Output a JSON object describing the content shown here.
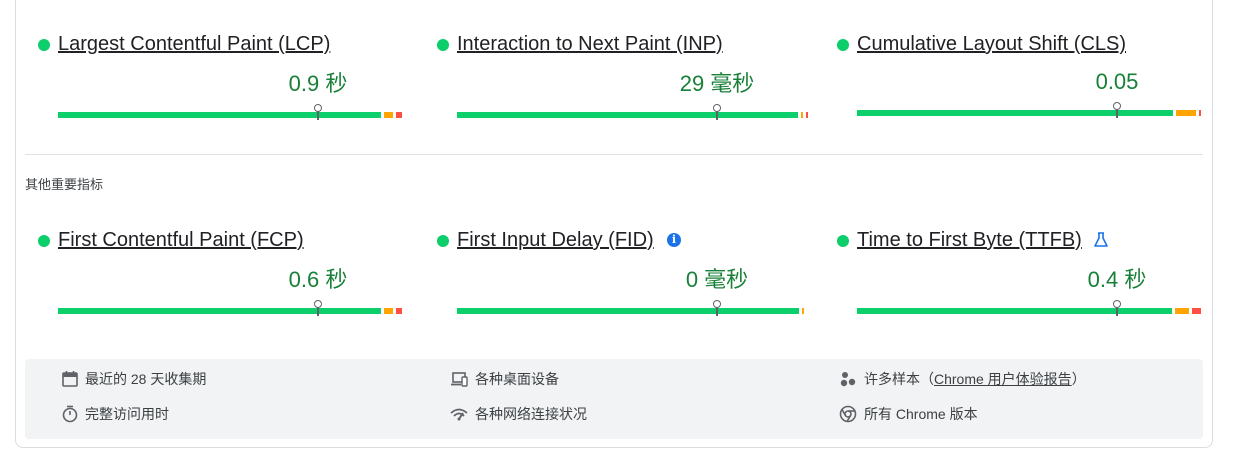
{
  "colors": {
    "good": "#0cce6b",
    "needs_improvement": "#ffa400",
    "poor": "#ff4e42",
    "value_text": "#188038",
    "info_blue": "#1a73e8"
  },
  "core_metrics": [
    {
      "name": "Largest Contentful Paint (LCP)",
      "value": "0.9 秒",
      "status": "good",
      "distribution": {
        "good": 0.94,
        "needs_improvement": 0.035,
        "poor": 0.025
      },
      "marker_fraction": 0.75
    },
    {
      "name": "Interaction to Next Paint (INP)",
      "value": "29 毫秒",
      "status": "good",
      "distribution": {
        "good": 0.99,
        "needs_improvement": 0.007,
        "poor": 0.003
      },
      "marker_fraction": 0.75
    },
    {
      "name": "Cumulative Layout Shift (CLS)",
      "value": "0.05",
      "status": "good",
      "distribution": {
        "good": 0.92,
        "needs_improvement": 0.065,
        "poor": 0.015
      },
      "marker_fraction": 0.75
    }
  ],
  "other_section_label": "其他重要指标",
  "other_metrics": [
    {
      "name": "First Contentful Paint (FCP)",
      "value": "0.6 秒",
      "status": "good",
      "distribution": {
        "good": 0.94,
        "needs_improvement": 0.035,
        "poor": 0.025
      },
      "marker_fraction": 0.75
    },
    {
      "name": "First Input Delay (FID)",
      "value": "0 毫秒",
      "status": "good",
      "distribution": {
        "good": 0.995,
        "needs_improvement": 0.005,
        "poor": 0.0
      },
      "marker_fraction": 0.75,
      "icon": "info-icon"
    },
    {
      "name": "Time to First Byte (TTFB)",
      "value": "0.4 秒",
      "status": "good",
      "distribution": {
        "good": 0.915,
        "needs_improvement": 0.05,
        "poor": 0.035
      },
      "marker_fraction": 0.75,
      "icon": "experimental-flask-icon"
    }
  ],
  "footer": {
    "period": {
      "icon": "calendar-icon",
      "text": "最近的 28 天收集期"
    },
    "devices": {
      "icon": "devices-icon",
      "text": "各种桌面设备"
    },
    "samples": {
      "icon": "samples-icon",
      "prefix": "许多样本（",
      "link": "Chrome 用户体验报告",
      "suffix": "）"
    },
    "duration": {
      "icon": "stopwatch-icon",
      "text": "完整访问用时"
    },
    "network": {
      "icon": "network-icon",
      "text": "各种网络连接状况"
    },
    "versions": {
      "icon": "chrome-icon",
      "text": "所有 Chrome 版本"
    }
  }
}
